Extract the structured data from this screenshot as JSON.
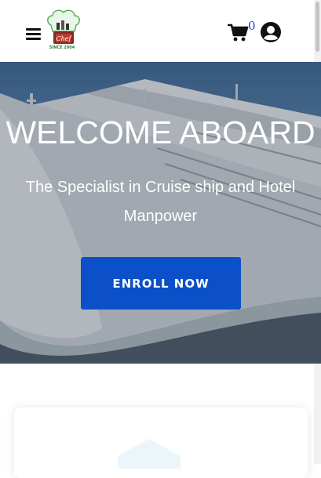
{
  "header": {
    "menu_icon": "hamburger-menu-icon",
    "logo": {
      "tagline": "SINCE 2004",
      "badge_text": "Chef"
    },
    "cart": {
      "icon": "shopping-cart-icon",
      "count": "0"
    },
    "user_icon": "user-circle-icon"
  },
  "hero": {
    "title": "WELCOME ABOARD",
    "subtitle": "The Specialist in Cruise ship and Hotel Manpower",
    "cta_label": "ENROLL NOW"
  },
  "colors": {
    "cta_background": "#0b4fc9",
    "cart_count": "#1e3fd1",
    "logo_green": "#2e7d32"
  }
}
